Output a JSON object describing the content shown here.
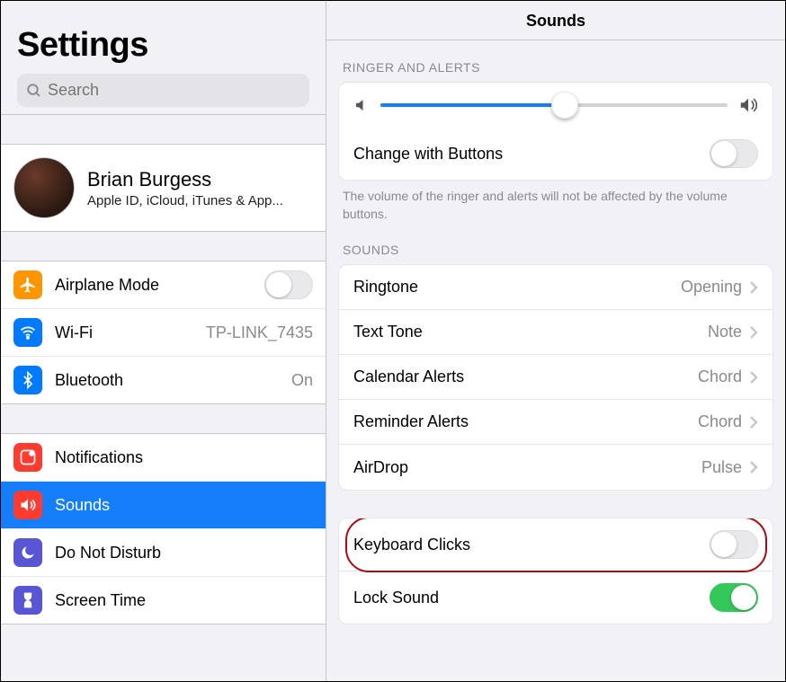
{
  "sidebar": {
    "title": "Settings",
    "search_placeholder": "Search",
    "profile": {
      "name": "Brian Burgess",
      "sub": "Apple ID, iCloud, iTunes & App..."
    },
    "group1": [
      {
        "label": "Airplane Mode",
        "icon_bg": "#ff9500",
        "type": "toggle",
        "on": false
      },
      {
        "label": "Wi-Fi",
        "icon_bg": "#007aff",
        "type": "link",
        "value": "TP-LINK_7435"
      },
      {
        "label": "Bluetooth",
        "icon_bg": "#007aff",
        "type": "link",
        "value": "On"
      }
    ],
    "group2": [
      {
        "label": "Notifications",
        "icon_bg": "#ff3b30",
        "type": "link",
        "value": ""
      },
      {
        "label": "Sounds",
        "icon_bg": "#ff3b30",
        "type": "link",
        "value": "",
        "selected": true
      },
      {
        "label": "Do Not Disturb",
        "icon_bg": "#5856d6",
        "type": "link",
        "value": ""
      },
      {
        "label": "Screen Time",
        "icon_bg": "#5856d6",
        "type": "link",
        "value": ""
      }
    ]
  },
  "content": {
    "title": "Sounds",
    "ringer_section": "RINGER AND ALERTS",
    "slider_value": 53,
    "change_with_buttons": {
      "label": "Change with Buttons",
      "on": false
    },
    "ringer_note": "The volume of the ringer and alerts will not be affected by the volume buttons.",
    "sounds_section": "SOUNDS",
    "sounds": [
      {
        "label": "Ringtone",
        "value": "Opening"
      },
      {
        "label": "Text Tone",
        "value": "Note"
      },
      {
        "label": "Calendar Alerts",
        "value": "Chord"
      },
      {
        "label": "Reminder Alerts",
        "value": "Chord"
      },
      {
        "label": "AirDrop",
        "value": "Pulse"
      }
    ],
    "toggles": [
      {
        "label": "Keyboard Clicks",
        "on": false,
        "highlight": true
      },
      {
        "label": "Lock Sound",
        "on": true
      }
    ]
  }
}
